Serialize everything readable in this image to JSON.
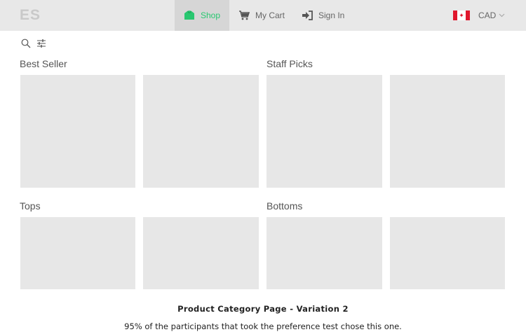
{
  "header": {
    "logo": "ES",
    "nav": {
      "shop": "Shop",
      "cart": "My Cart",
      "signin": "Sign In"
    },
    "currency": "CAD",
    "flag_icon": "canada-flag-icon",
    "accent_color": "#29c770"
  },
  "toolbar": {
    "search_icon": "search-icon",
    "filter_icon": "sliders-icon"
  },
  "sections": {
    "best_seller": "Best Seller",
    "staff_picks": "Staff Picks",
    "tops": "Tops",
    "bottoms": "Bottoms"
  },
  "caption": {
    "title": "Product Category Page - Variation 2",
    "subtitle": "95% of the participants that took the preference test chose this one."
  }
}
